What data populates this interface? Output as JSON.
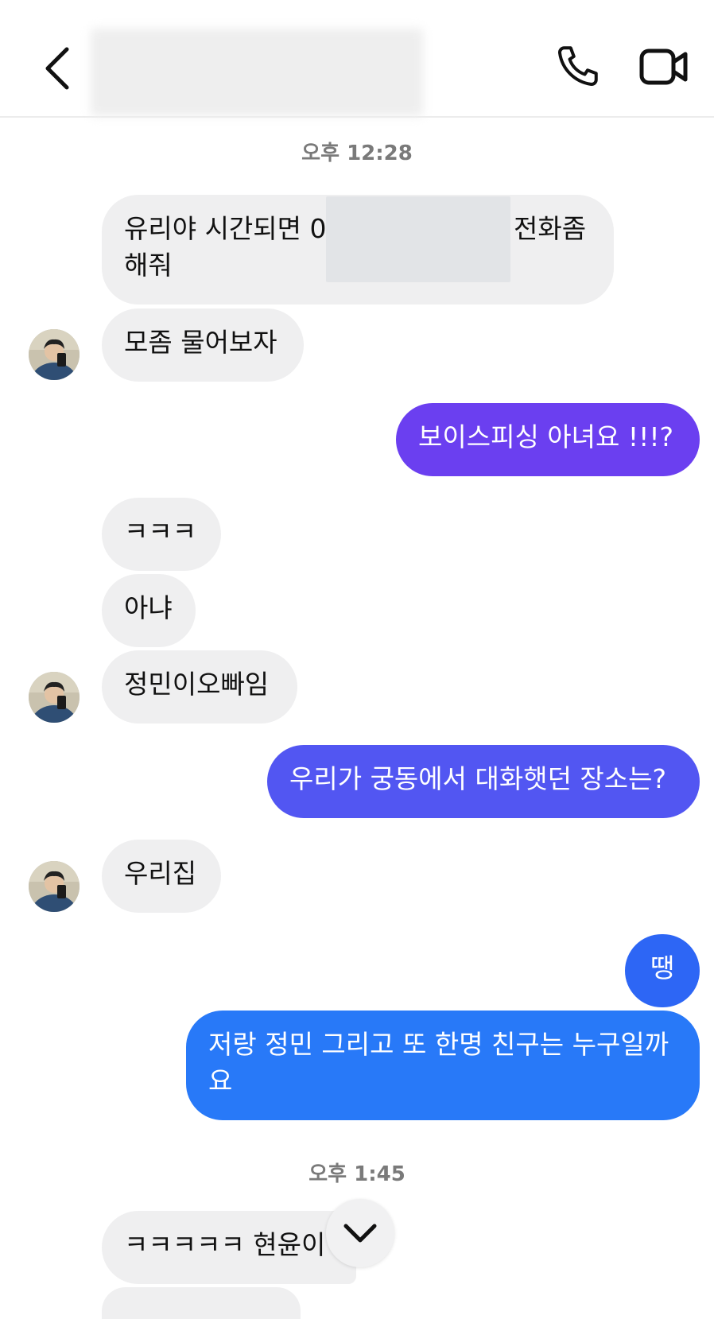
{
  "header": {
    "back_icon": "chevron-left-icon",
    "call_icon": "phone-icon",
    "video_icon": "video-camera-icon"
  },
  "timestamps": [
    "오후 12:28",
    "오후 1:45"
  ],
  "messages": [
    {
      "sender": "them",
      "line1": "유리야 시간되면 0",
      "line1_end": "전화좀",
      "line2": "해줘"
    },
    {
      "sender": "them",
      "text": "모좀 물어보자"
    },
    {
      "sender": "me",
      "text": "보이스피싱 아녀요 !!!?",
      "color": "#6b3ff0"
    },
    {
      "sender": "them",
      "text": "ㅋㅋㅋ"
    },
    {
      "sender": "them",
      "text": "아냐"
    },
    {
      "sender": "them",
      "text": "정민이오빠임"
    },
    {
      "sender": "me",
      "text": "우리가 궁동에서 대화햇던 장소는?",
      "color": "#5256f2"
    },
    {
      "sender": "them",
      "text": "우리집"
    },
    {
      "sender": "me",
      "text": "땡",
      "color": "#2d66f5"
    },
    {
      "sender": "me",
      "line1": "저랑 정민 그리고 또 한명 친구는 누구일까",
      "line2": "요",
      "color": "#2879f8"
    },
    {
      "sender": "them",
      "text": "ㅋㅋㅋㅋㅋ 현윤이"
    }
  ],
  "scroll_down_icon": "chevron-down-icon",
  "colors": {
    "incoming_bubble": "#efeff0",
    "outgoing_gradient": [
      "#6b3ff0",
      "#5256f2",
      "#2d66f5",
      "#2879f8"
    ]
  }
}
